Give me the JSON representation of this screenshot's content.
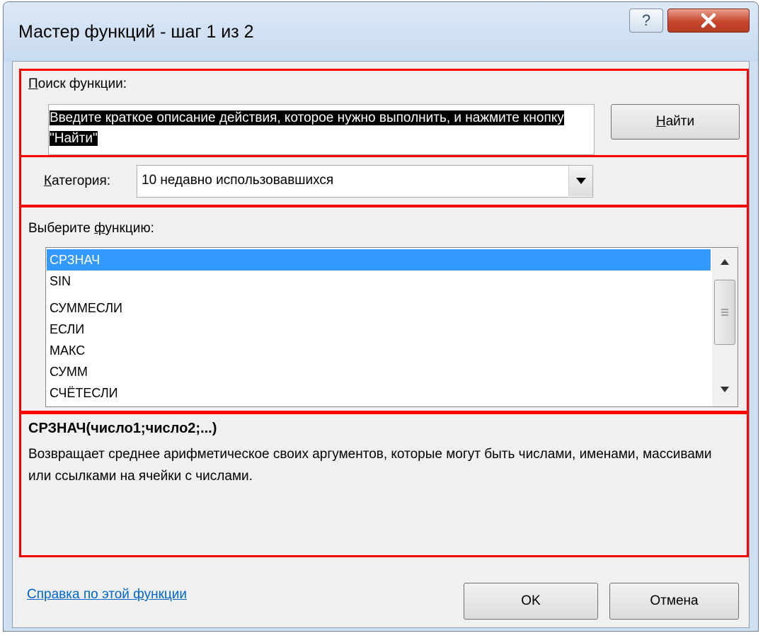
{
  "window": {
    "title": "Мастер функций - шаг 1 из 2",
    "help_button": "?",
    "close_button": "X"
  },
  "search": {
    "label_accel": "П",
    "label_rest": "оиск функции:",
    "text": "Введите краткое описание действия, которое нужно выполнить, и нажмите кнопку \"Найти\"",
    "button_accel": "Н",
    "button_rest": "айти"
  },
  "category": {
    "label_accel": "К",
    "label_rest": "атегория:",
    "selected": "10 недавно использовавшихся"
  },
  "function_list": {
    "label_pre": "Выберите ",
    "label_accel": "ф",
    "label_post": "ункцию:",
    "items": [
      "СРЗНАЧ",
      "SIN",
      "СУММЕСЛИ",
      "ЕСЛИ",
      "МАКС",
      "СУММ",
      "СЧЁТЕСЛИ"
    ],
    "selected_index": 0
  },
  "description": {
    "signature": "СРЗНАЧ(число1;число2;...)",
    "text": "Возвращает среднее арифметическое своих аргументов, которые могут быть числами, именами, массивами или ссылками на ячейки с числами."
  },
  "footer": {
    "help_link": "Справка по этой функции",
    "ok_button": "OK",
    "cancel_button": "Отмена"
  },
  "colors": {
    "highlight_frame": "#ff0000",
    "selection": "#3399ff",
    "link": "#0066cc"
  }
}
